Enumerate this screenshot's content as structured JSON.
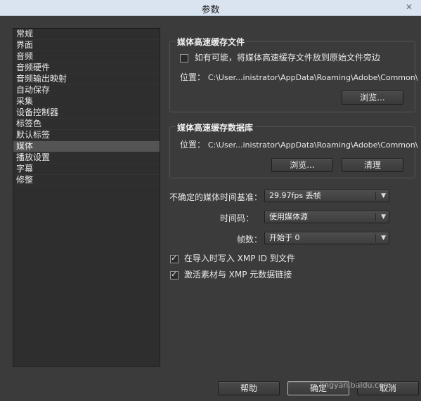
{
  "window": {
    "title": "参数",
    "close_glyph": "✕"
  },
  "sidebar": {
    "items": [
      {
        "label": "常规"
      },
      {
        "label": "界面"
      },
      {
        "label": "音频"
      },
      {
        "label": "音频硬件"
      },
      {
        "label": "音频输出映射"
      },
      {
        "label": "自动保存"
      },
      {
        "label": "采集"
      },
      {
        "label": "设备控制器"
      },
      {
        "label": "标签色"
      },
      {
        "label": "默认标签"
      },
      {
        "label": "媒体",
        "selected": true
      },
      {
        "label": "播放设置"
      },
      {
        "label": "字幕"
      },
      {
        "label": "修整"
      }
    ]
  },
  "media_cache_files": {
    "title": "媒体高速缓存文件",
    "checkbox_label": "如有可能，将媒体高速缓存文件放到原始文件旁边",
    "checked": false,
    "location_label": "位置：",
    "location_value": "C:\\User...inistrator\\AppData\\Roaming\\Adobe\\Common\\",
    "browse_label": "浏览..."
  },
  "media_cache_db": {
    "title": "媒体高速缓存数据库",
    "location_label": "位置：",
    "location_value": "C:\\User...inistrator\\AppData\\Roaming\\Adobe\\Common\\",
    "browse_label": "浏览...",
    "clean_label": "清理"
  },
  "settings": {
    "timebase_label": "不确定的媒体时间基准：",
    "timebase_value": "29.97fps 丢帧",
    "timecode_label": "时间码：",
    "timecode_value": "使用媒体源",
    "frame_label": "帧数：",
    "frame_value": "开始于 0",
    "xmp_write_label": "在导入时写入 XMP ID 到文件",
    "xmp_write_checked": true,
    "xmp_link_label": "激活素材与 XMP 元数据链接",
    "xmp_link_checked": true
  },
  "footer": {
    "help_label": "帮助",
    "ok_label": "确定",
    "cancel_label": "取消"
  },
  "watermark": "jingyan.baidu.com"
}
